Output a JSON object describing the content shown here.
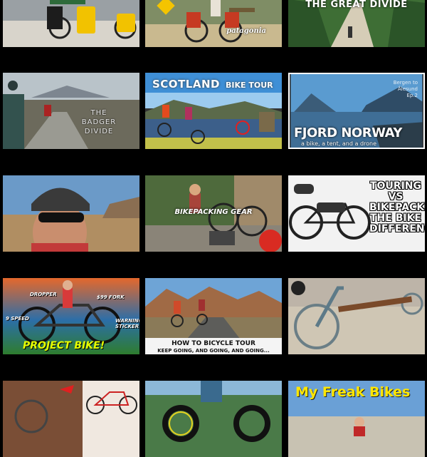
{
  "videos": [
    {
      "overlay_text": ""
    },
    {
      "overlay_text": "patagonia"
    },
    {
      "overlay_text": "THE GREAT DIVIDE"
    },
    {
      "overlay_text": "THE BADGER DIVIDE"
    },
    {
      "overlay_text": "SCOTLAND",
      "overlay_text_2": "BIKE TOUR"
    },
    {
      "overlay_text": "FJORD NORWAY",
      "overlay_text_2": "a bike, a tent, and a drone",
      "overlay_text_3": "Bergen to Ålesund Ep.2"
    },
    {
      "overlay_text": ""
    },
    {
      "overlay_text": "BIKEPACKING GEAR"
    },
    {
      "overlay_text": "TOURING VS BIKEPACKING THE BIKE DIFFERENCES"
    },
    {
      "overlay_text": "PROJECT BIKE!",
      "labels": [
        "DROPPER",
        "$99 FORK",
        "9 SPEED",
        "WARNING STICKER"
      ]
    },
    {
      "overlay_text": "HOW TO BICYCLE TOUR",
      "overlay_text_2": "KEEP GOING, AND GOING, AND GOING..."
    },
    {
      "overlay_text": ""
    },
    {
      "overlay_text": ""
    },
    {
      "overlay_text": ""
    },
    {
      "overlay_text": "My Freak Bikes"
    }
  ]
}
